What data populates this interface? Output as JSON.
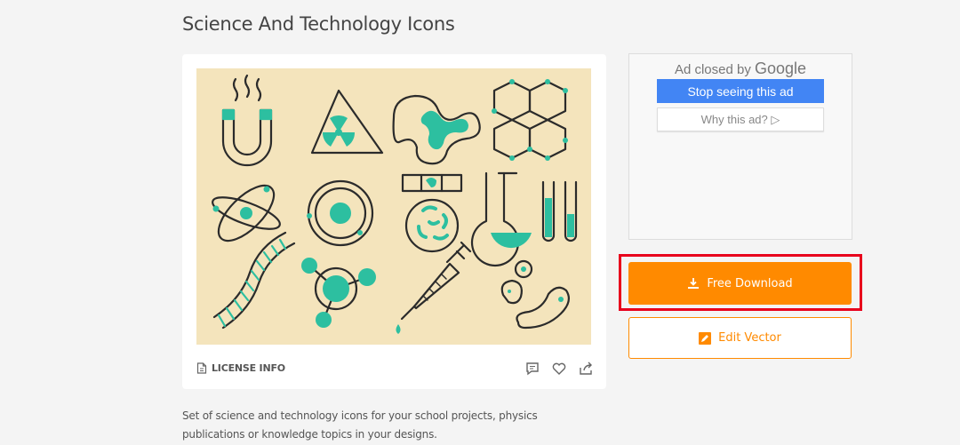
{
  "page": {
    "title": "Science And Technology Icons"
  },
  "preview": {
    "background_color": "#f4e4bc",
    "accent_color": "#2dbfa0",
    "line_color": "#2b2b2b",
    "icons": [
      "magnet-icon",
      "radiation-icon",
      "molecule-blob-icon",
      "hexagon-structure-icon",
      "atom-icon",
      "orbit-icon",
      "petri-dish-icon",
      "flask-icon",
      "test-tubes-icon",
      "dna-icon",
      "molecule-icon",
      "syringe-icon",
      "cells-icon"
    ]
  },
  "card": {
    "license_label": "LICENSE INFO",
    "actions": [
      "comment-icon",
      "heart-icon",
      "share-icon"
    ]
  },
  "ad": {
    "closed_by": "Ad closed by",
    "brand": "Google",
    "stop_label": "Stop seeing this ad",
    "why_label": "Why this ad?"
  },
  "actions": {
    "download_label": "Free Download",
    "edit_label": "Edit Vector",
    "download_color": "#ff8a00",
    "highlight_color": "#e8001c"
  },
  "description": {
    "text": "Set of science and technology icons for your school projects, physics publications or knowledge topics in your designs."
  }
}
